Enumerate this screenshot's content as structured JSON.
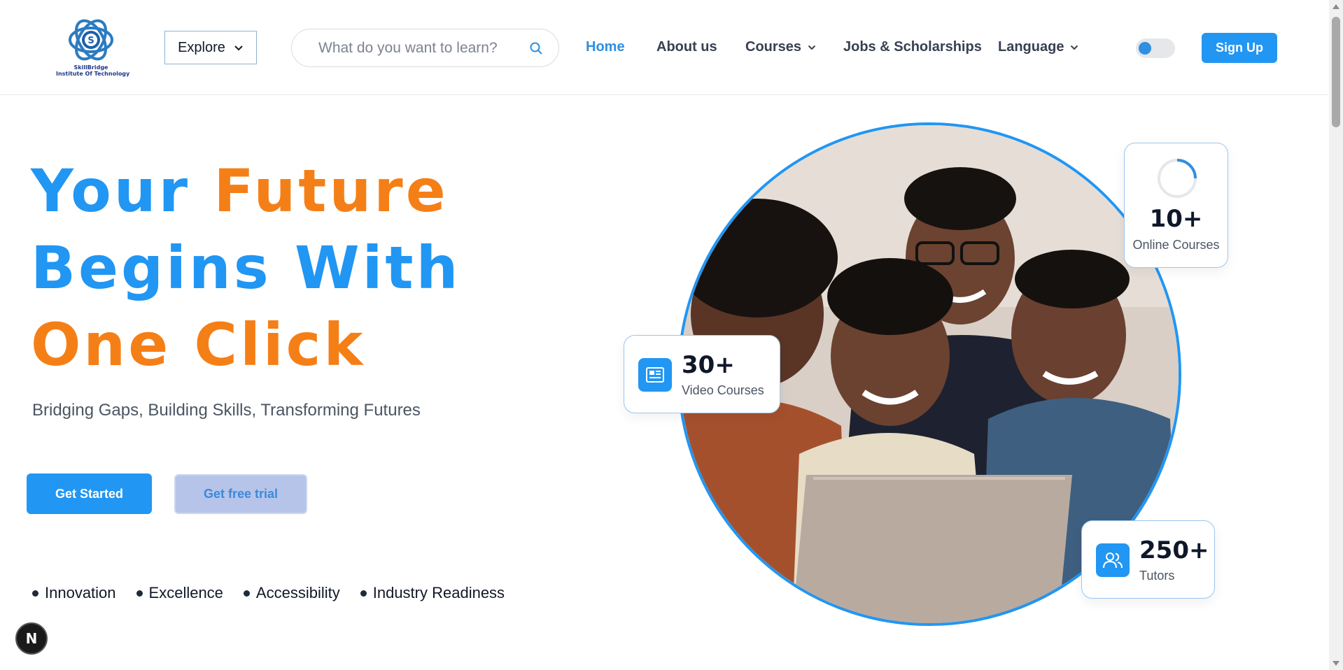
{
  "logo": {
    "line1": "SkillBridge",
    "line2": "Institute Of Technology"
  },
  "header": {
    "explore_label": "Explore",
    "search_placeholder": "What do you want to learn?",
    "nav": [
      {
        "label": "Home",
        "active": true
      },
      {
        "label": "About us"
      },
      {
        "label": "Courses",
        "has_dropdown": true
      },
      {
        "label": "Jobs & Scholarships"
      },
      {
        "label": "Language",
        "has_dropdown": true
      }
    ],
    "signup_label": "Sign Up",
    "accent_color": "#2196f3"
  },
  "hero": {
    "headline": {
      "line1_a": "Your",
      "line1_b": "Future",
      "line2": "Begins With",
      "line3": "One Click"
    },
    "subtitle": "Bridging Gaps, Building Skills, Transforming Futures",
    "primary_cta": "Get Started",
    "secondary_cta": "Get free trial",
    "values": [
      "Innovation",
      "Excellence",
      "Accessibility",
      "Industry Readiness"
    ],
    "colors": {
      "blue": "#2196f3",
      "orange": "#f57f17"
    }
  },
  "stats": {
    "video": {
      "number": "30+",
      "label": "Video Courses",
      "icon": "video-course-icon"
    },
    "online": {
      "number": "10+",
      "label": "Online Courses",
      "icon": "loading-spinner-icon"
    },
    "tutors": {
      "number": "250+",
      "label": "Tutors",
      "icon": "users-icon"
    }
  },
  "dev_badge": "N"
}
